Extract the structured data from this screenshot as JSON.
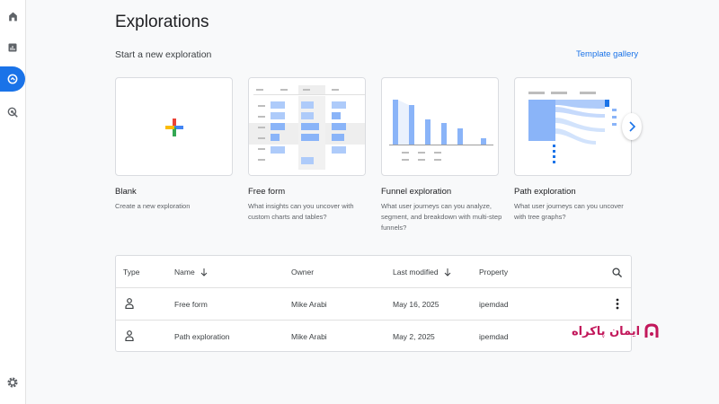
{
  "page": {
    "title": "Explorations",
    "subtitle": "Start a new exploration",
    "gallery_link": "Template gallery"
  },
  "rail": {
    "items": [
      "home-icon",
      "reports-icon",
      "explore-icon",
      "advertising-icon"
    ],
    "bottom": "settings-icon",
    "active": "explore-icon",
    "accent": "#1a73e8"
  },
  "cards": [
    {
      "title": "Blank",
      "desc": "Create a new exploration"
    },
    {
      "title": "Free form",
      "desc": "What insights can you uncover with custom charts and tables?"
    },
    {
      "title": "Funnel exploration",
      "desc": "What user journeys can you analyze, segment, and breakdown with multi-step funnels?"
    },
    {
      "title": "Path exploration",
      "desc": "What user journeys can you uncover with tree graphs?"
    }
  ],
  "table": {
    "headers": {
      "type": "Type",
      "name": "Name",
      "owner": "Owner",
      "modified": "Last modified",
      "property": "Property"
    },
    "rows": [
      {
        "name": "Free form",
        "owner": "Mike Arabi",
        "modified": "May 16, 2025",
        "property": "ipemdad"
      },
      {
        "name": "Path exploration",
        "owner": "Mike Arabi",
        "modified": "May 2, 2025",
        "property": "ipemdad"
      }
    ]
  },
  "watermark": {
    "text": "ایمان پاکراه",
    "color": "#c2185b"
  }
}
